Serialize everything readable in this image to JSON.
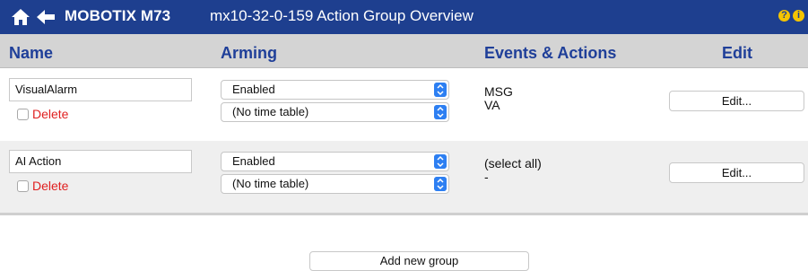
{
  "header": {
    "brand": "MOBOTIX M73",
    "title": "mx10-32-0-159 Action Group Overview",
    "home_icon": "home-icon",
    "back_icon": "back-arrow-icon",
    "help_glyph": "?",
    "info_glyph": "i",
    "bar_color": "#1e3f8f"
  },
  "columns": {
    "name": "Name",
    "arming": "Arming",
    "events": "Events & Actions",
    "edit": "Edit"
  },
  "groups": [
    {
      "name": "VisualAlarm",
      "delete_label": "Delete",
      "arming_value": "Enabled",
      "time_table_value": "(No time table)",
      "events": [
        "MSG",
        "VA"
      ],
      "edit_label": "Edit..."
    },
    {
      "name": "AI Action",
      "delete_label": "Delete",
      "arming_value": "Enabled",
      "time_table_value": "(No time table)",
      "events": [
        "(select all)",
        "-"
      ],
      "edit_label": "Edit..."
    }
  ],
  "footer": {
    "add_group_label": "Add new group"
  },
  "colors": {
    "accent": "#2d7ff2",
    "heading_text": "#1f3f99",
    "delete_text": "#e02020"
  }
}
